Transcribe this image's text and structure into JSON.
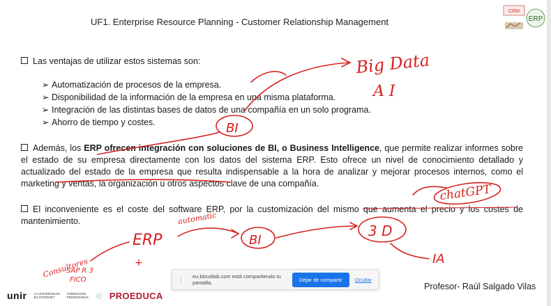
{
  "header": {
    "title": "UF1. Enterprise Resource Planning - Customer Relationship Management"
  },
  "logo": {
    "crm_label": "CRM",
    "erp_label": "ERP"
  },
  "intro": {
    "text": "Las ventajas de utilizar estos sistemas son:"
  },
  "advantages": [
    "Automatización de procesos de la empresa.",
    "Disponibilidad de la información de la empresa en una misma plataforma.",
    "Integración de las distintas bases de datos de una compañía en un solo programa.",
    "Ahorro de tiempo y costes."
  ],
  "para1": {
    "pre": "Además, los ",
    "bold1": "ERP",
    "bold2": " ofrecen integración con soluciones de BI, o Business Intelligence",
    "post": ", que permite realizar informes sobre el estado de su empresa directamente con los datos del sistema ERP. Esto ofrece un nivel de conocimiento detallado y actualizado del estado de la empresa que resulta indispensable a la hora de analizar y mejorar procesos internos, como el marketing y ventas, la organización u otros aspectos clave de una compañía."
  },
  "para2": {
    "text": "El inconveniente es el coste del software ERP, por la customización del mismo que aumenta el precio y los costes de mantenimiento."
  },
  "annotations": {
    "big_data": "Big Data",
    "ai": "A I",
    "bi_top": "BI",
    "chatgpt": "chatGPT",
    "erp": "ERP",
    "bi_bottom": "BI",
    "automatic": "automatic",
    "three_d": "3 D",
    "ia": "IA",
    "consultores": "Consultores",
    "sap": "SAP R 3",
    "fico": "FICO",
    "plus": "+"
  },
  "share_bar": {
    "message": "eu.bbcollab.com está compartiendo tu pantalla.",
    "stop_button": "Dejar de compartir",
    "hide_link": "Ocultar"
  },
  "footer": {
    "unir": "unir",
    "unir_sub1": "LA UNIVERSIDAD",
    "unir_sub2": "EN INTERNET",
    "fp1": "FORMACIÓN",
    "fp2": "PROFESIONAL",
    "proeduca": "PROEDUCA",
    "professor": "Profesor- Raúl Salgado Vilas"
  },
  "colors": {
    "ink": "#d62020",
    "accent_button": "#1a73e8",
    "brand": "#b01c2e"
  }
}
